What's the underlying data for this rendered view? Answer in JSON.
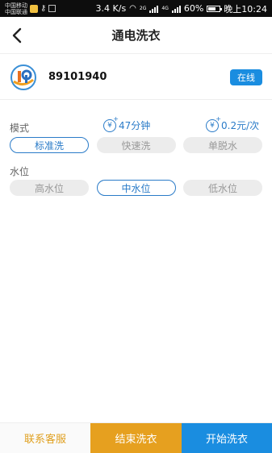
{
  "statusbar": {
    "carrier1": "中国移动",
    "carrier2": "中国联通",
    "speed": "3.4 K/s",
    "net1": "2G",
    "net2": "4G",
    "battery": "60%",
    "battery_level": 0.6,
    "time": "晚上10:24"
  },
  "header": {
    "title": "通电洗衣"
  },
  "device": {
    "id": "89101940",
    "status": "在线"
  },
  "mode": {
    "label": "模式",
    "duration": "47分钟",
    "price": "0.2元/次",
    "options": [
      "标准洗",
      "快速洗",
      "单脱水"
    ],
    "selected": 0
  },
  "water": {
    "label": "水位",
    "options": [
      "高水位",
      "中水位",
      "低水位"
    ],
    "selected": 1
  },
  "bottom": {
    "contact": "联系客服",
    "end": "结束洗衣",
    "start": "开始洗衣"
  },
  "colors": {
    "accent": "#1a8de0",
    "warning": "#e6a01f",
    "text_blue": "#2a7bc8"
  }
}
